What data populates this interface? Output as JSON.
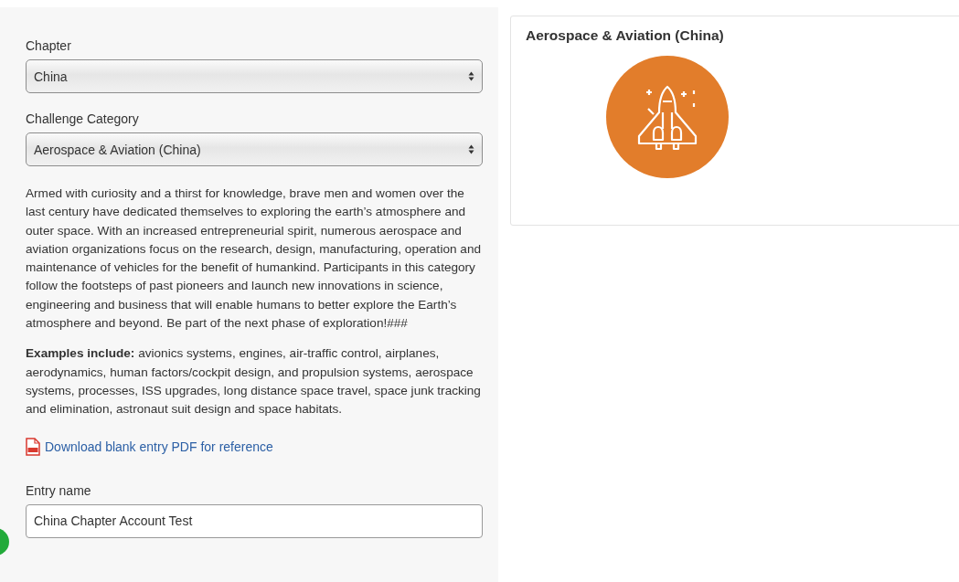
{
  "form": {
    "chapter": {
      "label": "Chapter",
      "value": "China"
    },
    "category": {
      "label": "Challenge Category",
      "value": "Aerospace & Aviation (China)"
    },
    "description": "Armed with curiosity and a thirst for knowledge, brave men and women over the last century have dedicated themselves to exploring the earth’s atmosphere and outer space. With an increased entrepreneurial spirit, numerous aerospace and aviation organizations focus on the research, design, manufacturing, operation and maintenance of vehicles for the benefit of humankind. Participants in this category follow the footsteps of past pioneers and launch new innovations in science, engineering and business that will enable humans to better explore the Earth’s atmosphere and beyond. Be part of the next phase of exploration!###",
    "examples": "**Examples include:** avionics systems, engines, air-traffic control, airplanes, aerodynamics, human factors/cockpit design, and propulsion systems, aerospace systems, processes, ISS upgrades, long distance space travel, space junk tracking and elimination, astronaut suit design and space habitats.",
    "download_link": "Download blank entry PDF for reference",
    "entry_name": {
      "label": "Entry name",
      "value": "China Chapter Account Test"
    }
  },
  "category_card": {
    "title": "Aerospace & Aviation (China)"
  }
}
